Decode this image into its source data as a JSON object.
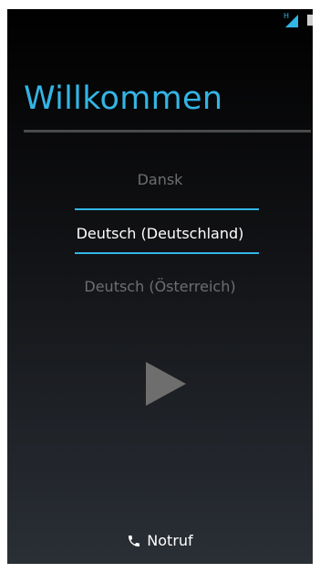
{
  "status_bar": {
    "network_type": "H"
  },
  "welcome": {
    "title": "Willkommen"
  },
  "languages": {
    "items": [
      "Dansk",
      "Deutsch (Deutschland)",
      "Deutsch (Österreich)"
    ],
    "selected": "Deutsch (Deutschland)"
  },
  "actions": {
    "start_icon": "play-icon",
    "emergency_icon": "phone-icon",
    "emergency_label": "Notruf"
  },
  "colors": {
    "accent": "#33b5e5",
    "dim_text": "#6e6e6e",
    "text": "#ffffff"
  }
}
